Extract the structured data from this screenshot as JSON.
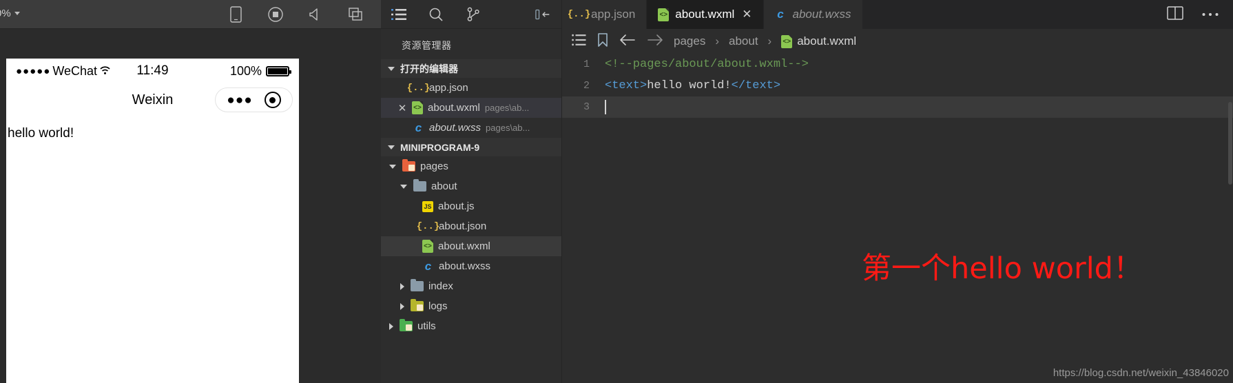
{
  "simulator": {
    "zoom_label": "0%",
    "toolbar_icons": [
      "phone-icon",
      "record-icon",
      "volume-icon",
      "windows-icon"
    ],
    "phone": {
      "carrier": "WeChat",
      "signal_dots": "●●●●●",
      "time": "11:49",
      "battery_percent": "100%",
      "nav_title": "Weixin",
      "capsule_dots": "●●●",
      "page_text": "hello world!"
    }
  },
  "sidebar": {
    "toolbar_icons": [
      "explorer-icon",
      "search-icon",
      "source-control-icon",
      "collapse-sidebar-icon"
    ],
    "title": "资源管理器",
    "open_editors": {
      "label": "打开的编辑器",
      "items": [
        {
          "name": "app.json",
          "path": "",
          "icon": "json-icon",
          "closable": false,
          "selected": false,
          "italic": false
        },
        {
          "name": "about.wxml",
          "path": "pages\\ab...",
          "icon": "wxml-icon",
          "closable": true,
          "selected": true,
          "italic": false
        },
        {
          "name": "about.wxss",
          "path": "pages\\ab...",
          "icon": "wxss-icon",
          "closable": false,
          "selected": false,
          "italic": true
        }
      ]
    },
    "project": {
      "label": "MINIPROGRAM-9",
      "tree": [
        {
          "name": "pages",
          "type": "folder",
          "color": "orange",
          "depth": 1,
          "expanded": true,
          "selected": false
        },
        {
          "name": "about",
          "type": "folder",
          "color": "gray",
          "depth": 2,
          "expanded": true,
          "selected": false
        },
        {
          "name": "about.js",
          "type": "file",
          "icon": "js-icon",
          "depth": 3,
          "selected": false
        },
        {
          "name": "about.json",
          "type": "file",
          "icon": "json-icon",
          "depth": 3,
          "selected": false
        },
        {
          "name": "about.wxml",
          "type": "file",
          "icon": "wxml-icon",
          "depth": 3,
          "selected": true
        },
        {
          "name": "about.wxss",
          "type": "file",
          "icon": "wxss-icon",
          "depth": 3,
          "selected": false
        },
        {
          "name": "index",
          "type": "folder",
          "color": "gray",
          "depth": 2,
          "expanded": false,
          "selected": false
        },
        {
          "name": "logs",
          "type": "folder",
          "color": "olive",
          "depth": 2,
          "expanded": false,
          "selected": false
        },
        {
          "name": "utils",
          "type": "folder",
          "color": "green",
          "depth": 1,
          "expanded": false,
          "selected": false
        }
      ]
    }
  },
  "editor": {
    "tabs": [
      {
        "label": "app.json",
        "icon": "json-icon",
        "active": false,
        "closable": false,
        "italic": false
      },
      {
        "label": "about.wxml",
        "icon": "wxml-icon",
        "active": true,
        "closable": true,
        "italic": false
      },
      {
        "label": "about.wxss",
        "icon": "wxss-icon",
        "active": false,
        "closable": false,
        "italic": true
      }
    ],
    "tab_actions": [
      "split-editor-icon",
      "more-actions-icon"
    ],
    "breadcrumb": {
      "icons": [
        "outline-icon",
        "bookmark-icon",
        "back-arrow-icon",
        "forward-arrow-icon"
      ],
      "parts": [
        "pages",
        "about",
        "about.wxml"
      ],
      "separator": "›",
      "file_icon": "wxml-icon"
    },
    "code": {
      "lines": [
        {
          "number": "1",
          "comment": "<!--pages/about/about.wxml-->"
        },
        {
          "number": "2",
          "open_tag": "<text>",
          "text": "hello world!",
          "close_tag": "</text>"
        },
        {
          "number": "3",
          "current": true
        }
      ]
    },
    "annotation": "第一个hello world！",
    "watermark": "https://blog.csdn.net/weixin_43846020"
  },
  "colors": {
    "annotation_red": "#ff1a15",
    "accent_green": "#8cc751",
    "accent_yellow": "#e8c14d",
    "accent_blue": "#3d9ae2"
  }
}
